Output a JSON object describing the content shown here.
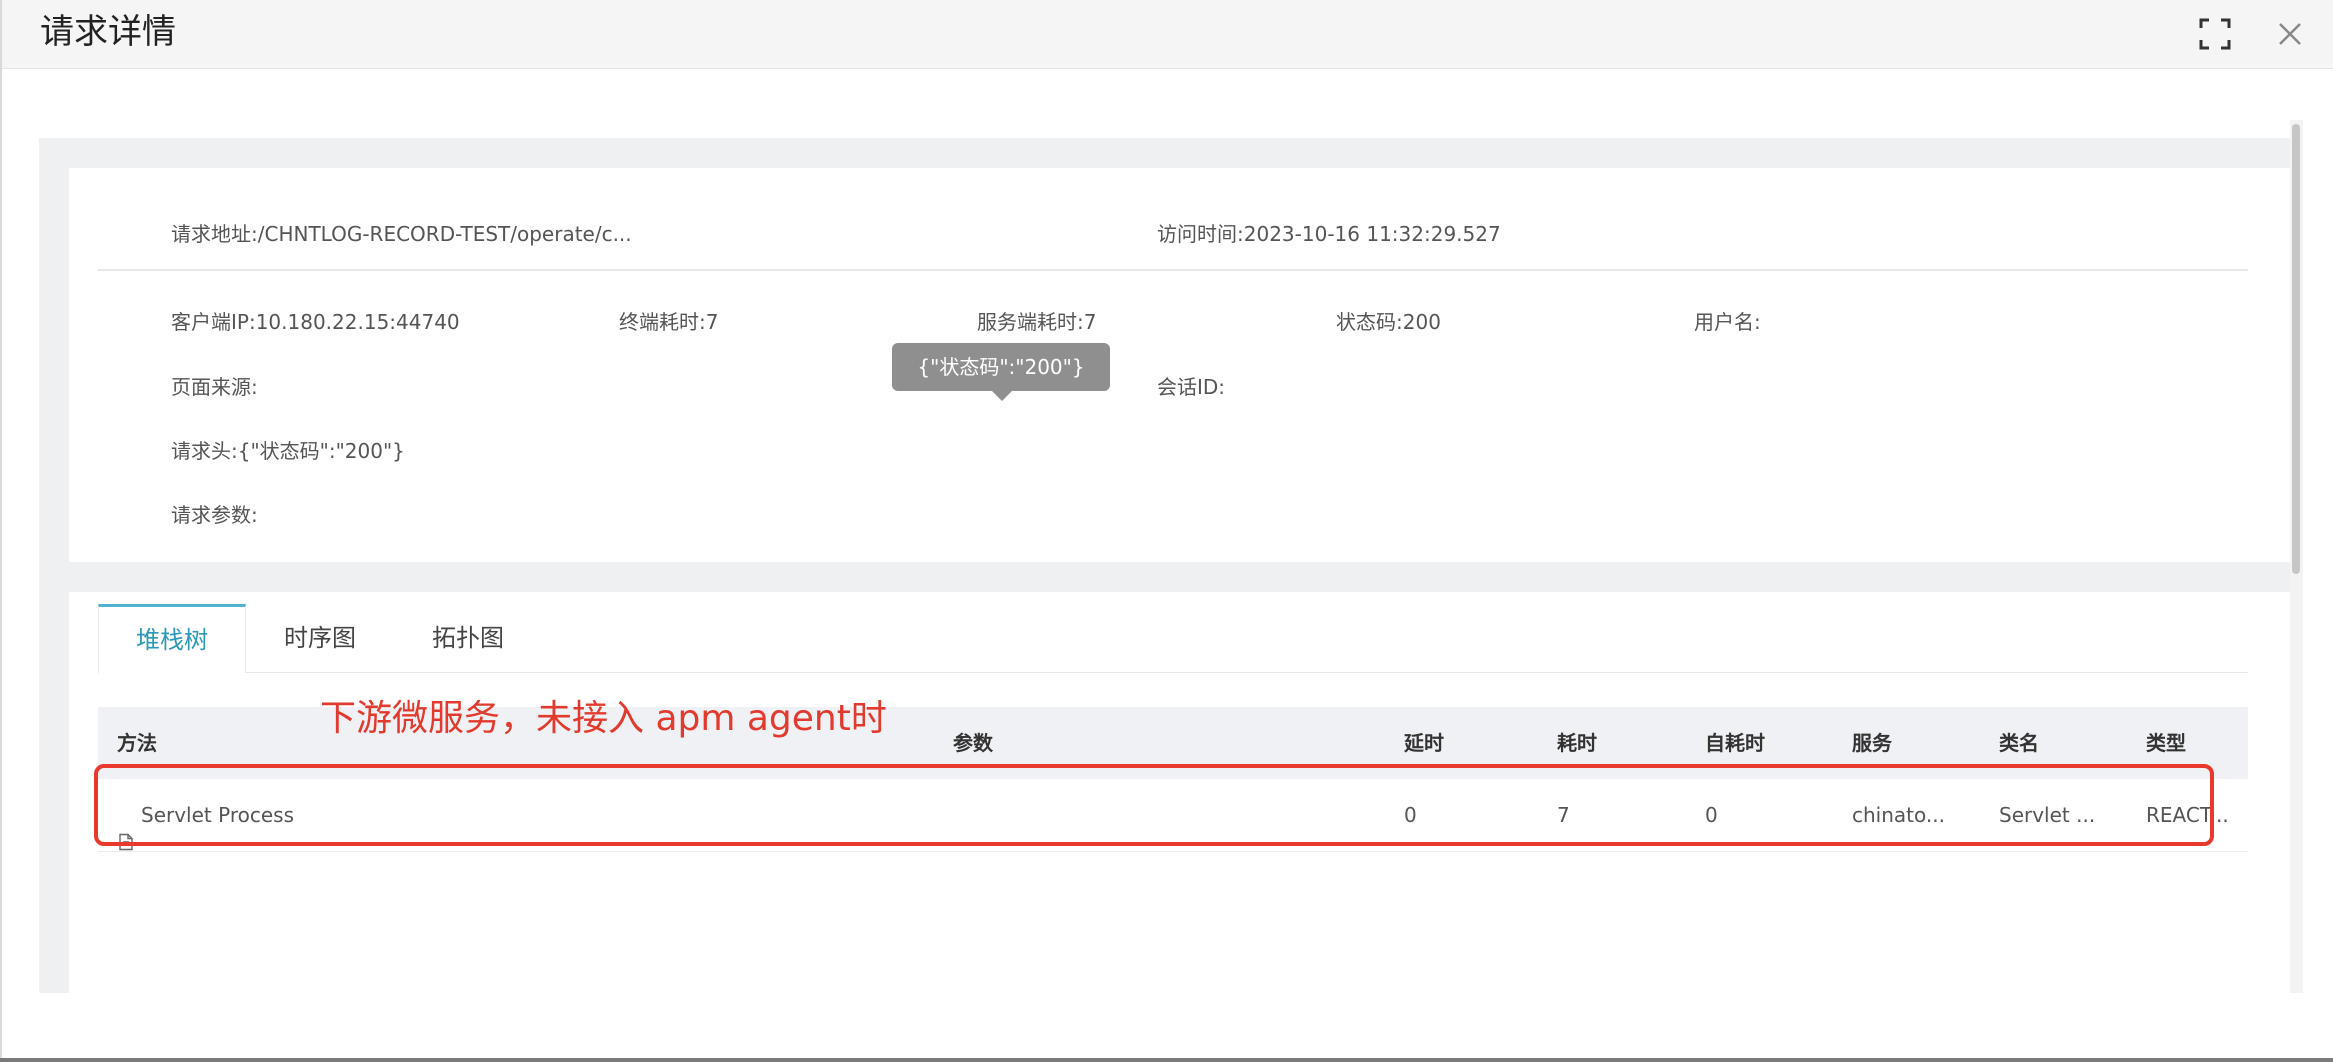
{
  "dialog": {
    "title": "请求详情",
    "fullscreen_icon": "fullscreen-icon",
    "close_icon": "close-icon"
  },
  "info": {
    "request_url_label": "请求地址:",
    "request_url_value": "/CHNTLOG-RECORD-TEST/operate/c...",
    "visit_time_label": "访问时间:",
    "visit_time_value": "2023-10-16 11:32:29.527",
    "client_ip_label": "客户端IP:",
    "client_ip_value": "10.180.22.15:44740",
    "client_cost_label": "终端耗时:",
    "client_cost_value": "7",
    "server_cost_label": "服务端耗时:",
    "server_cost_value": "7",
    "status_label": "状态码:",
    "status_value": "200",
    "username_label": "用户名:",
    "username_value": "",
    "page_source_label": "页面来源:",
    "page_source_value": "",
    "session_label": "会话ID:",
    "session_value": "",
    "request_header_label": "请求头:",
    "request_header_value": "{\"状态码\":\"200\"}",
    "request_params_label": "请求参数:",
    "request_params_value": "",
    "tooltip_text": "{\"状态码\":\"200\"}"
  },
  "tabs": [
    {
      "label": "堆栈树",
      "active": true
    },
    {
      "label": "时序图",
      "active": false
    },
    {
      "label": "拓扑图",
      "active": false
    }
  ],
  "table": {
    "columns": [
      "方法",
      "参数",
      "延时",
      "耗时",
      "自耗时",
      "服务",
      "类名",
      "类型"
    ],
    "rows": [
      {
        "method": "Servlet Process",
        "method_icon": "document-icon",
        "params": "",
        "delay": "0",
        "cost": "7",
        "self_cost": "0",
        "service": "chinato...",
        "class_name": "Servlet ...",
        "type": "REACT..."
      }
    ]
  },
  "annotation": {
    "text": "下游微服务，未接入 apm agent时",
    "color": "#e23a2e"
  },
  "colors": {
    "accent": "#2b98b9",
    "highlight": "#e8392c"
  }
}
